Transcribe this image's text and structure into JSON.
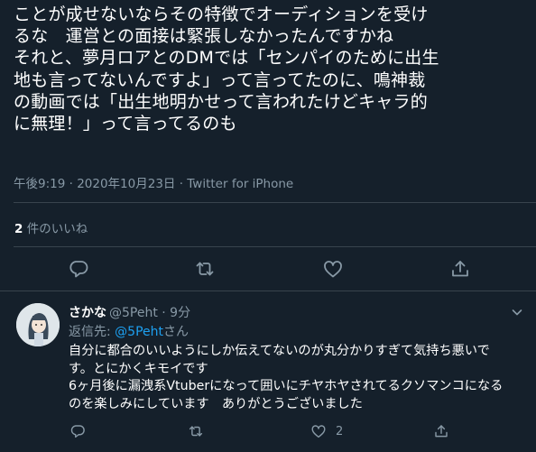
{
  "tweet": {
    "text": "ことが成せないならその特徴でオーディションを受け\nるな　運営との面接は緊張しなかったんですかね\nそれと、夢月ロアとのDMでは「センパイのために出生\n地も言ってないんですよ」って言ってたのに、鳴神裁\nの動画では「出生地明かせって言われたけどキャラ的\nに無理！」って言ってるのも",
    "meta": "午後9:19 · 2020年10月23日 · Twitter for iPhone",
    "likes_count": "2",
    "likes_label": " 件のいいね"
  },
  "reply": {
    "name": "さかな",
    "handle": "@5Peht",
    "time": " · 9分",
    "reply_to_prefix": "返信先: ",
    "reply_to_handle": "@5Peht",
    "reply_to_suffix": "さん",
    "text": "自分に都合のいいようにしか伝えてないのが丸分かりすぎて気持ち悪いで\nす。とにかくキモイです\n6ヶ月後に漏洩系Vtuberになって囲いにチヤホヤされてるクソマンコになる\nのを楽しみにしています　ありがとうございました",
    "like_count": "2"
  },
  "icons": {
    "reply": "reply-icon",
    "retweet": "retweet-icon",
    "like": "heart-icon",
    "share": "share-icon",
    "more": "chevron-down-icon"
  },
  "colors": {
    "background": "#15202b",
    "text": "#ffffff",
    "secondary": "#8899a6",
    "link": "#1da1f2",
    "divider": "#38444d"
  }
}
